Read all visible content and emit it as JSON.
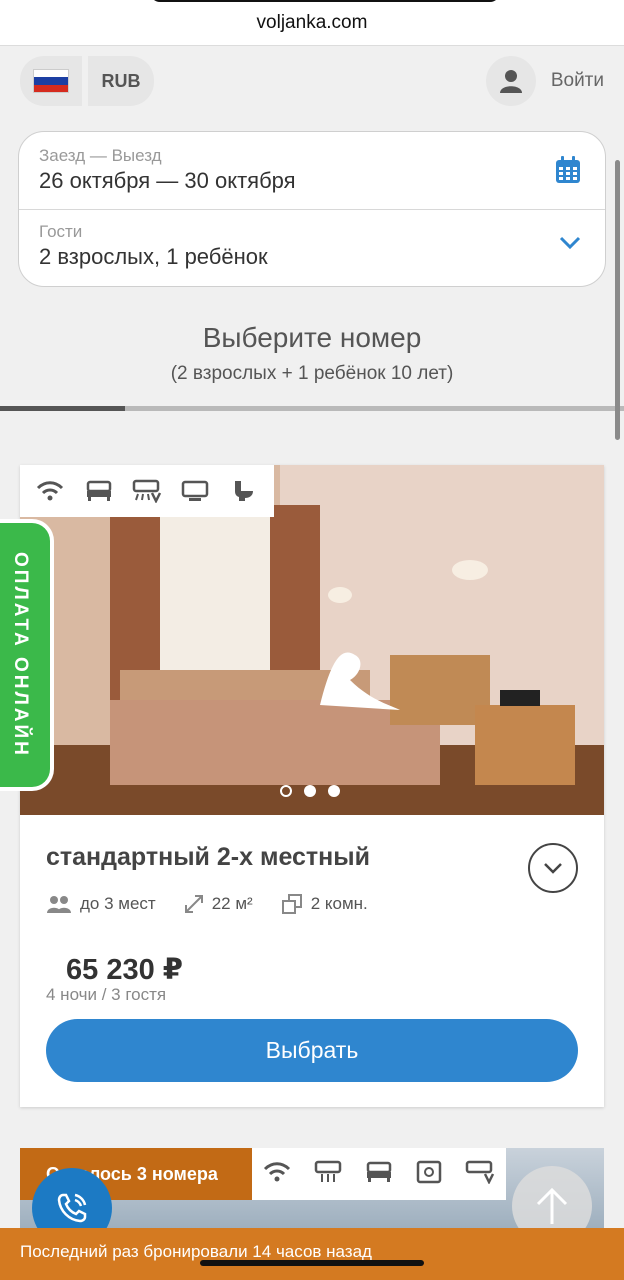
{
  "browser": {
    "url": "voljanka.com"
  },
  "header": {
    "flag_icon": "russia-flag-icon",
    "flag_colors": [
      "#ffffff",
      "#1c3fa3",
      "#d52b1e"
    ],
    "currency": "RUB",
    "login_label": "Войти"
  },
  "search": {
    "dates_label": "Заезд — Выезд",
    "dates_value": "26 октября — 30 октября",
    "guests_label": "Гости",
    "guests_value": "2 взрослых, 1 ребёнок"
  },
  "section": {
    "title": "Выберите номер",
    "subtitle": "(2 взрослых + 1 ребёнок 10 лет)",
    "progress_fraction": 0.2
  },
  "pay_tab": {
    "label": "ОПЛАТА ОНЛАЙН"
  },
  "room": {
    "amenities": [
      "wifi-icon",
      "bed-icon",
      "air-conditioner-icon",
      "tv-icon",
      "toilet-icon"
    ],
    "photo_count": 3,
    "active_photo": 0,
    "title": "стандартный 2-х местный",
    "capacity": "до 3 мест",
    "area": "22 м²",
    "rooms": "2 комн.",
    "price": "65 230 ₽",
    "price_note": "4 ночи / 3 гостя",
    "select_label": "Выбрать"
  },
  "room2": {
    "badge": "Осталось 3 номера",
    "amenities": [
      "wifi-icon",
      "air-conditioner-icon",
      "bed-icon",
      "safe-icon",
      "air-conditioner-icon"
    ]
  },
  "booking_notice": "Последний раз бронировали 14 часов назад",
  "colors": {
    "accent": "#2f86cf",
    "pay_green": "#3bb94a",
    "notice_orange": "#d47a21"
  }
}
